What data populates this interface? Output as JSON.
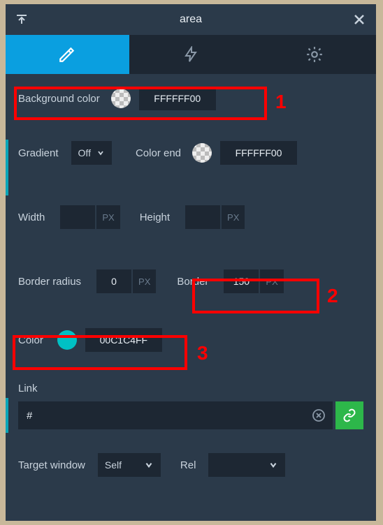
{
  "title": "area",
  "background_color": {
    "label": "Background color",
    "value": "FFFFFF00"
  },
  "gradient": {
    "label": "Gradient",
    "toggle": "Off"
  },
  "color_end": {
    "label": "Color end",
    "value": "FFFFFF00"
  },
  "width": {
    "label": "Width",
    "value": "",
    "unit": "PX"
  },
  "height": {
    "label": "Height",
    "value": "",
    "unit": "PX"
  },
  "border_radius": {
    "label": "Border radius",
    "value": "0",
    "unit": "PX"
  },
  "border": {
    "label": "Border",
    "value": "150",
    "unit": "PX"
  },
  "color": {
    "label": "Color",
    "value": "00C1C4FF",
    "swatch_hex": "#00c1c4"
  },
  "link": {
    "label": "Link",
    "value": "#"
  },
  "target_window": {
    "label": "Target window",
    "value": "Self"
  },
  "rel": {
    "label": "Rel",
    "value": ""
  },
  "annotations": {
    "a1": "1",
    "a2": "2",
    "a3": "3"
  }
}
